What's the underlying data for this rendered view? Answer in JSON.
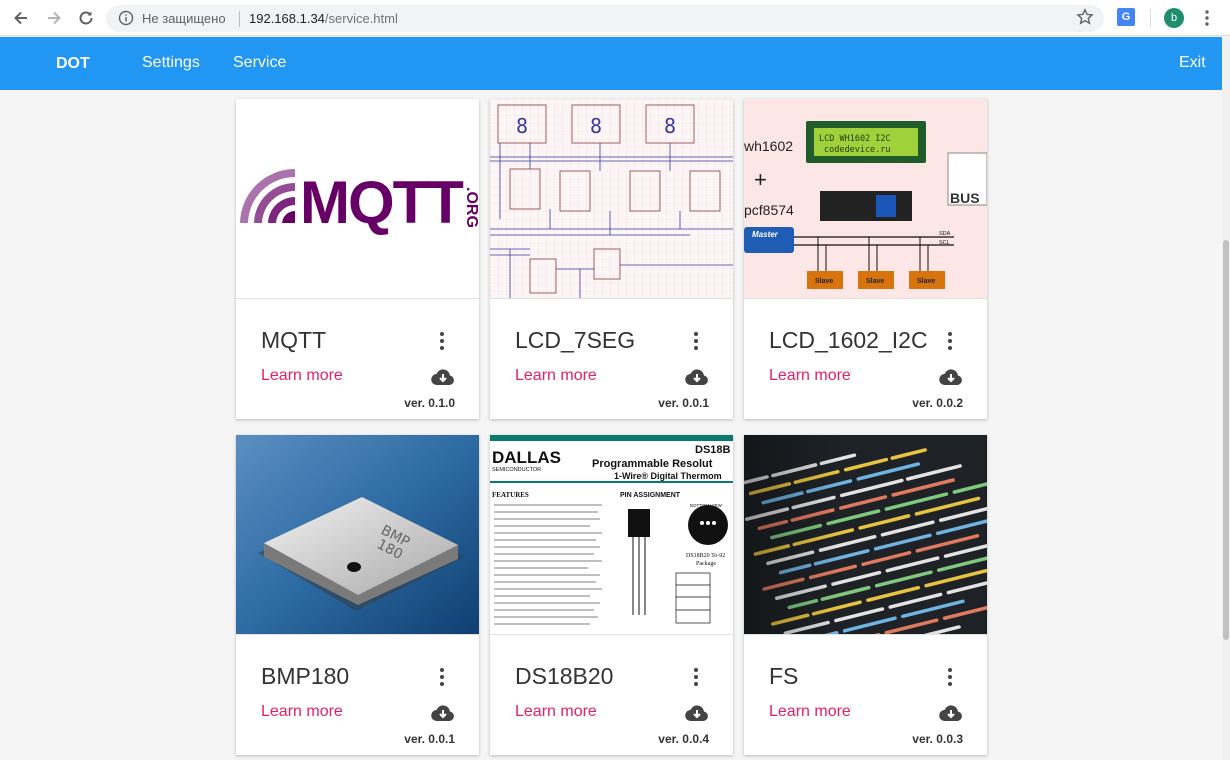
{
  "browser": {
    "status": "Не защищено",
    "url_host": "192.168.1.34",
    "url_path": "/service.html",
    "translate_label": "G",
    "profile_initial": "b"
  },
  "appbar": {
    "brand": "DOT",
    "nav": [
      "Settings",
      "Service"
    ],
    "exit": "Exit",
    "color": "#2196f3"
  },
  "cards": [
    {
      "title": "MQTT",
      "link": "Learn more",
      "version": "ver. 0.1.0",
      "image": "mqtt-logo"
    },
    {
      "title": "LCD_7SEG",
      "link": "Learn more",
      "version": "ver. 0.0.1",
      "image": "seven-segment-schematic"
    },
    {
      "title": "LCD_1602_I2C",
      "link": "Learn more",
      "version": "ver. 0.0.2",
      "image": "lcd1602-i2c-diagram"
    },
    {
      "title": "BMP180",
      "link": "Learn more",
      "version": "ver. 0.0.1",
      "image": "bmp180-sensor-photo"
    },
    {
      "title": "DS18B20",
      "link": "Learn more",
      "version": "ver. 0.0.4",
      "image": "ds18b20-datasheet"
    },
    {
      "title": "FS",
      "link": "Learn more",
      "version": "ver. 0.0.3",
      "image": "code-screen-photo"
    }
  ],
  "image_text": {
    "mqtt_logo": "MQTT",
    "mqtt_org": ".ORG",
    "lcd_screen_line1": "LCD WH1602 I2C",
    "lcd_screen_line2": "codedevice.ru",
    "lcd_label_a": "wh1602",
    "lcd_plus": "+",
    "lcd_label_b": "pcf8574",
    "lcd_master": "Master",
    "lcd_sda": "SDA",
    "lcd_scl": "SCL",
    "lcd_slave": "Slave",
    "lcd_bus": "BUS",
    "bmp_chip_line1": "BMP",
    "bmp_chip_line2": "180",
    "ds_brand": "DALLAS",
    "ds_sub": "SEMICONDUCTOR",
    "ds_part": "DS18B",
    "ds_title": "Programmable Resolut",
    "ds_subtitle": "1-Wire® Digital Thermom",
    "ds_features": "FEATURES",
    "ds_pin": "PIN ASSIGNMENT",
    "ds_bottom": "BOTTOM VIEW",
    "ds_pkg": "DS18B20 To-92",
    "ds_pkg2": "Package"
  }
}
